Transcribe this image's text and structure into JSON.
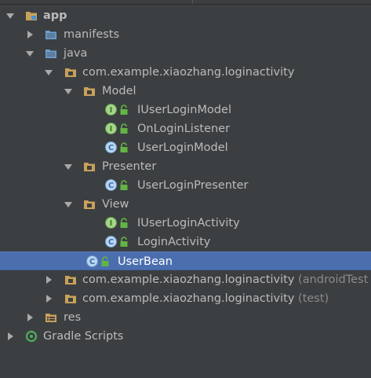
{
  "tree": {
    "app": "app",
    "manifests": "manifests",
    "java": "java",
    "pkg_main": "com.example.xiaozhang.loginactivity",
    "model": "Model",
    "iuserloginmodel": "IUserLoginModel",
    "onloginlistener": "OnLoginListener",
    "userloginmodel": "UserLoginModel",
    "presenter": "Presenter",
    "userloginpresenter": "UserLoginPresenter",
    "view": "View",
    "iuserloginactivity": "IUserLoginActivity",
    "loginactivity": "LoginActivity",
    "userbean": "UserBean",
    "pkg_androidtest": "com.example.xiaozhang.loginactivity",
    "pkg_androidtest_suffix": "(androidTest",
    "pkg_test": "com.example.xiaozhang.loginactivity",
    "pkg_test_suffix": "(test)",
    "res": "res",
    "gradle_scripts": "Gradle Scripts"
  },
  "icons": {
    "class_badge": "C",
    "interface_badge": "I"
  },
  "colors": {
    "background": "#3c3f41",
    "selection": "#4b6eaf",
    "text": "#bbbbbb",
    "folder": "#c9a15b",
    "java_folder": "#6d9fcf",
    "lock": "#62b543"
  }
}
